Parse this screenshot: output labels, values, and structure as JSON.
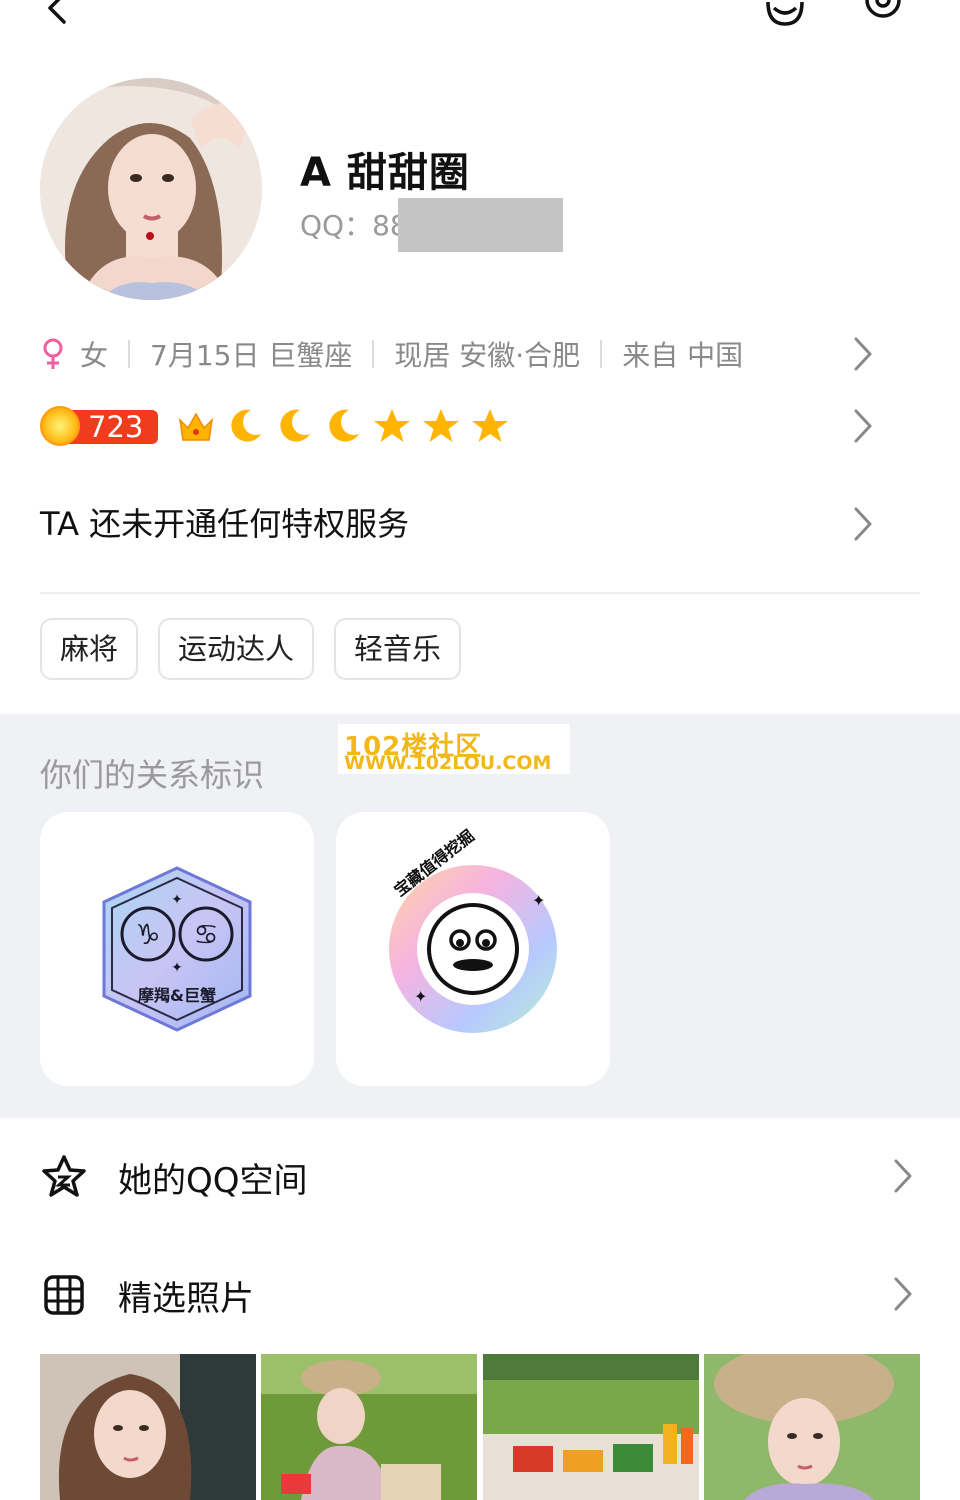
{
  "profile": {
    "nickname": "A 甜甜圈",
    "qq_label": "QQ：88"
  },
  "info": {
    "gender": "女",
    "birthday": "7月15日 巨蟹座",
    "residence": "现居 安徽·合肥",
    "origin": "来自 中国"
  },
  "level": {
    "value": "723",
    "icons": [
      "crown-icon",
      "moon-icon",
      "moon-icon",
      "moon-icon",
      "star-icon",
      "star-icon",
      "star-icon"
    ]
  },
  "privilege": {
    "text": "TA 还未开通任何特权服务"
  },
  "tags": [
    "麻将",
    "运动达人",
    "轻音乐"
  ],
  "relationship": {
    "title": "你们的关系标识",
    "badges": [
      {
        "label": "摩羯&巨蟹"
      },
      {
        "label": "宝藏值得挖掘"
      }
    ]
  },
  "watermark": {
    "line1": "102楼社区",
    "line2": "WWW.102LOU.COM"
  },
  "list": {
    "qzone_label": "她的QQ空间",
    "photos_label": "精选照片"
  },
  "colors": {
    "female": "#f05fa0",
    "level_badge": "#f03c1c",
    "section_bg": "#f0f1f5",
    "star": "#ffb400",
    "watermark": "#f2b81a"
  }
}
